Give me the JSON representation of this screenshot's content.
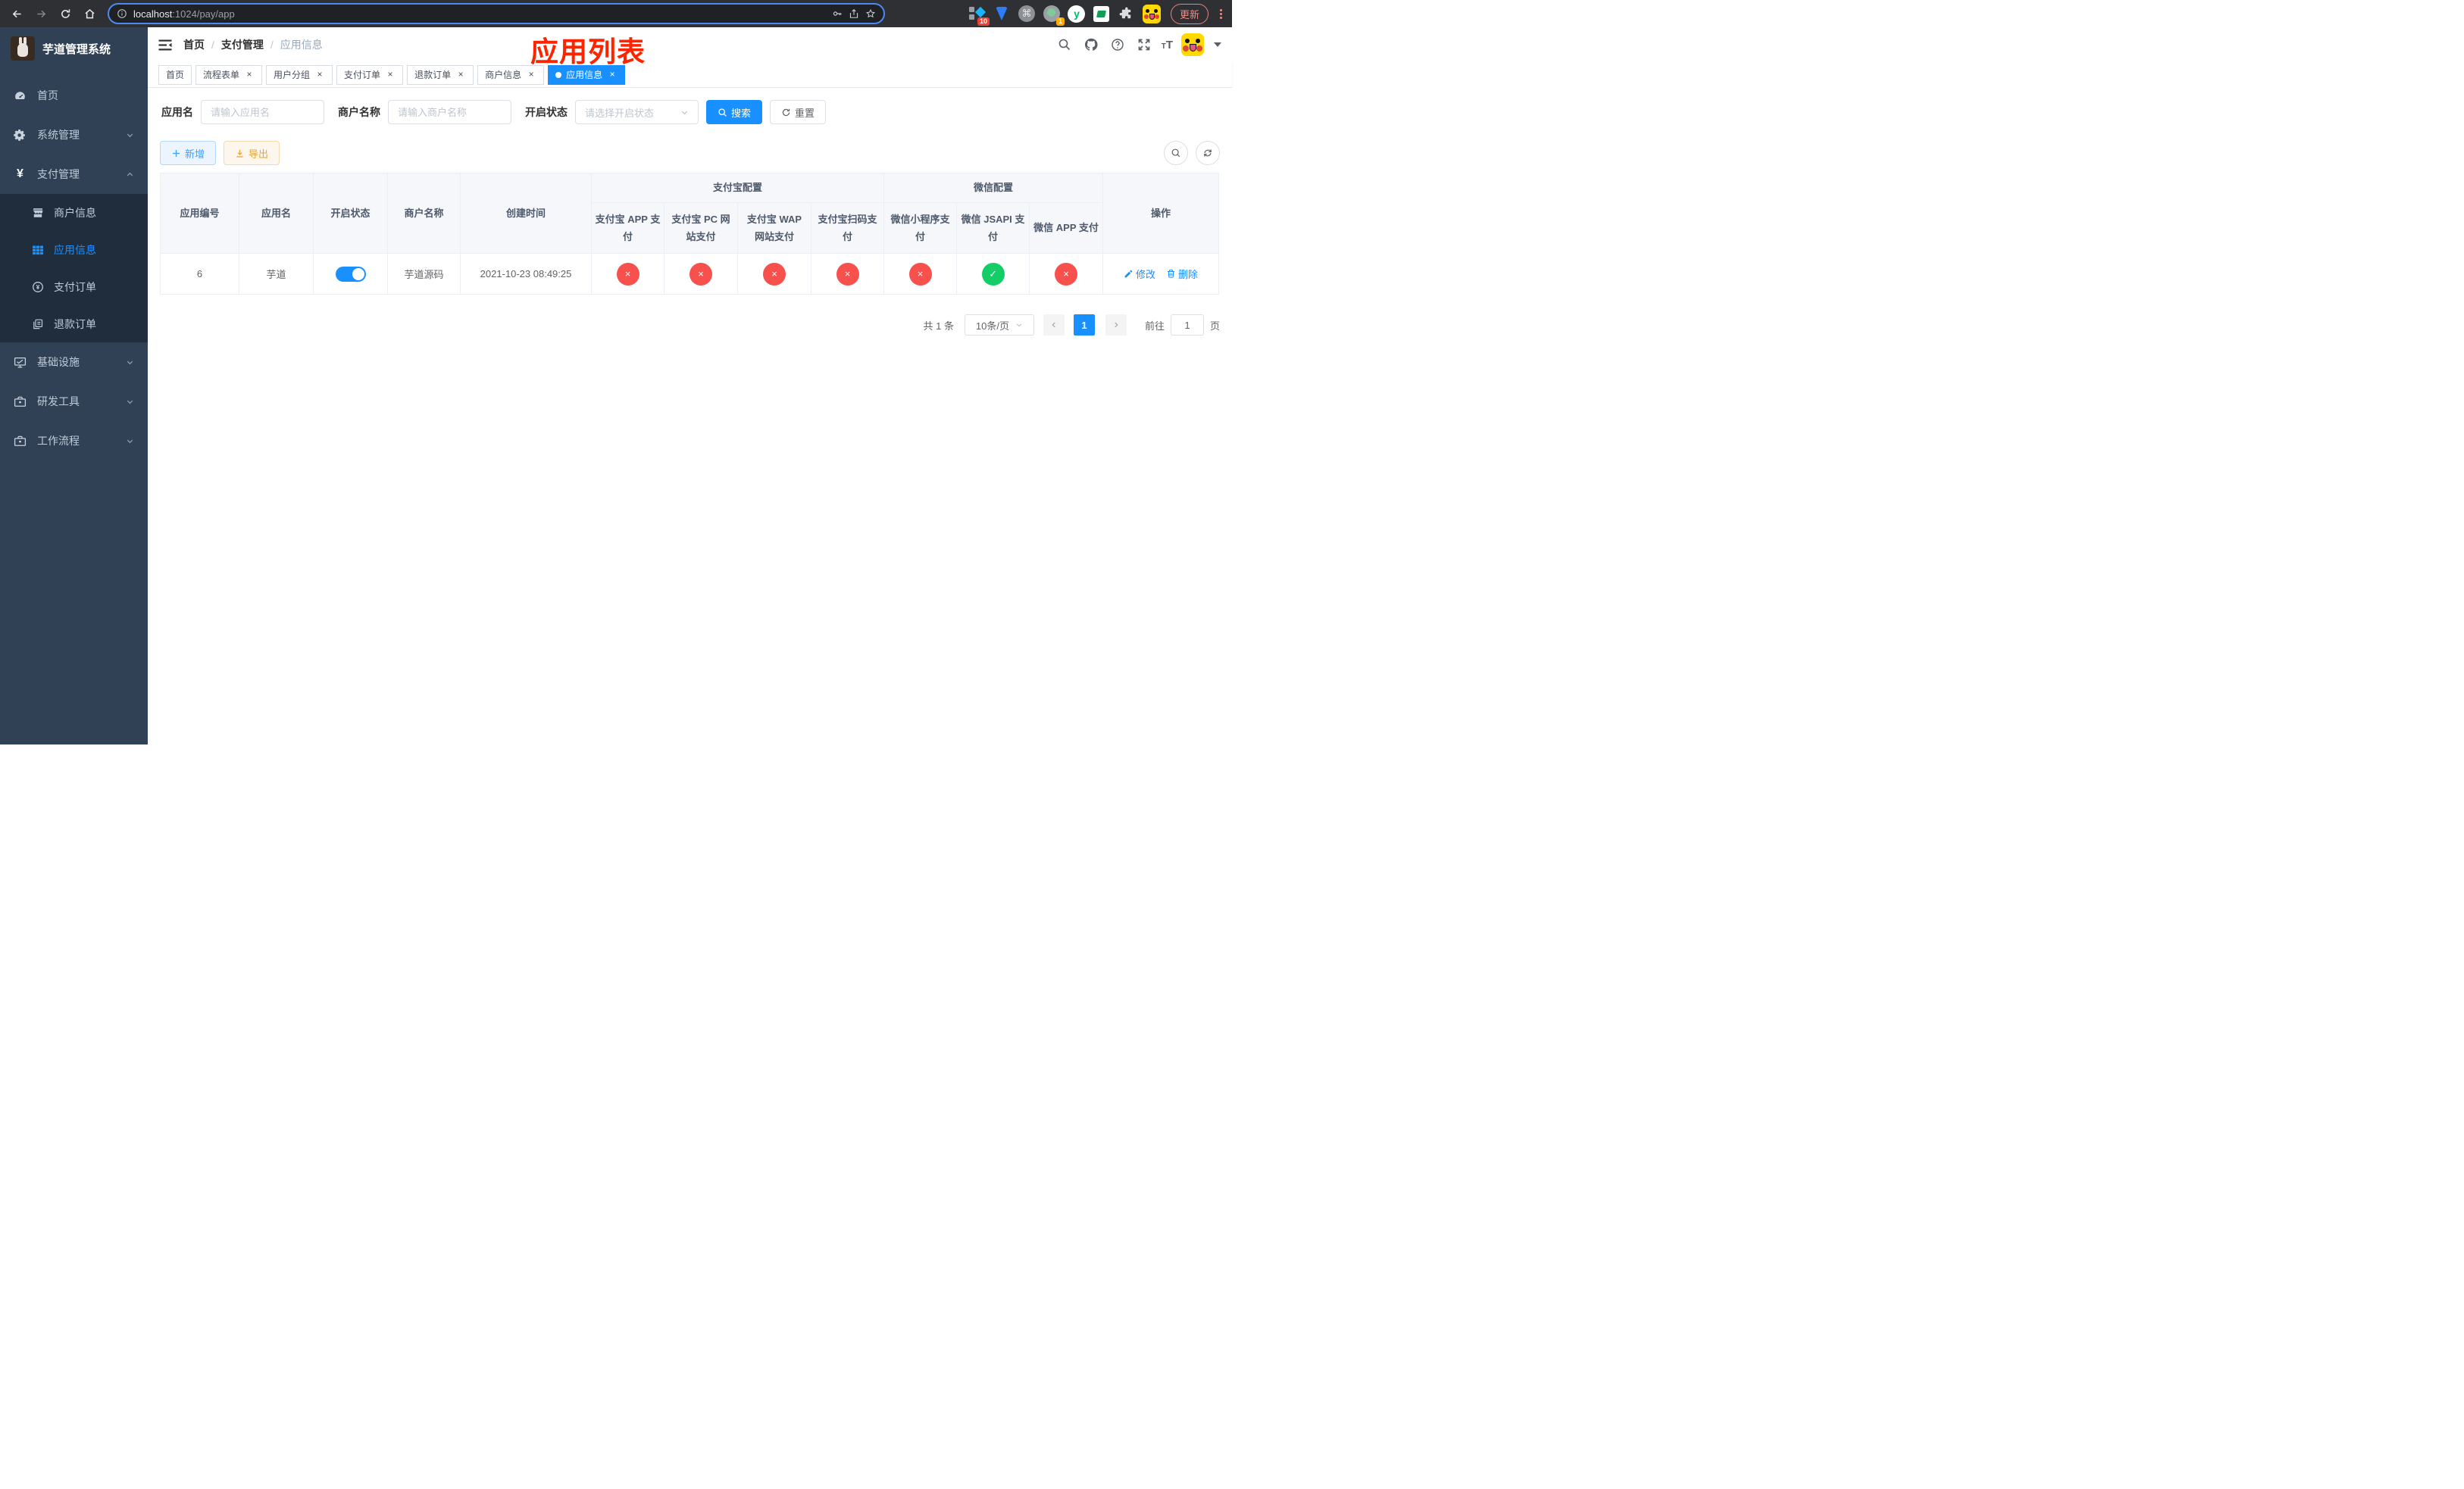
{
  "colors": {
    "accent": "#1890ff",
    "success": "#13ce66",
    "danger": "#f7504d",
    "sidebar_bg": "#304156",
    "submenu_bg": "#1f2d3d",
    "annotation_red": "#ff2400",
    "export_orange": "#e6a23c"
  },
  "browser": {
    "url_host": "localhost",
    "url_rest": ":1024/pay/app",
    "update_label": "更新",
    "ext_badge_diamond": "10",
    "ext_badge_dot": "1"
  },
  "sidebar": {
    "title": "芋道管理系统",
    "items": [
      {
        "label": "首页"
      },
      {
        "label": "系统管理"
      },
      {
        "label": "支付管理",
        "children": [
          {
            "label": "商户信息"
          },
          {
            "label": "应用信息",
            "active": true
          },
          {
            "label": "支付订单"
          },
          {
            "label": "退款订单"
          }
        ]
      },
      {
        "label": "基础设施"
      },
      {
        "label": "研发工具"
      },
      {
        "label": "工作流程"
      }
    ]
  },
  "navbar": {
    "breadcrumb": [
      "首页",
      "支付管理",
      "应用信息"
    ],
    "annotation": "应用列表"
  },
  "tabs": [
    {
      "label": "首页",
      "closable": false,
      "active": false
    },
    {
      "label": "流程表单",
      "closable": true,
      "active": false
    },
    {
      "label": "用户分组",
      "closable": true,
      "active": false
    },
    {
      "label": "支付订单",
      "closable": true,
      "active": false
    },
    {
      "label": "退款订单",
      "closable": true,
      "active": false
    },
    {
      "label": "商户信息",
      "closable": true,
      "active": false
    },
    {
      "label": "应用信息",
      "closable": true,
      "active": true
    }
  ],
  "filters": {
    "app_name_label": "应用名",
    "app_name_placeholder": "请输入应用名",
    "merchant_label": "商户名称",
    "merchant_placeholder": "请输入商户名称",
    "status_label": "开启状态",
    "status_placeholder": "请选择开启状态",
    "search_label": "搜索",
    "reset_label": "重置"
  },
  "toolbar": {
    "add_label": "新增",
    "export_label": "导出"
  },
  "table": {
    "group_headers": {
      "alipay": "支付宝配置",
      "wechat": "微信配置"
    },
    "columns": {
      "app_id": "应用编号",
      "app_name": "应用名",
      "status": "开启状态",
      "merchant": "商户名称",
      "created": "创建时间",
      "alipay_app": "支付宝 APP 支付",
      "alipay_pc": "支付宝 PC 网站支付",
      "alipay_wap": "支付宝 WAP 网站支付",
      "alipay_qr": "支付宝扫码支付",
      "wx_lite": "微信小程序支付",
      "wx_jsapi": "微信 JSAPI 支付",
      "wx_app": "微信 APP 支付",
      "actions": "操作"
    },
    "row": {
      "app_id": "6",
      "app_name": "芋道",
      "enabled": true,
      "merchant": "芋道源码",
      "created": "2021-10-23 08:49:25",
      "configs": {
        "alipay_app": false,
        "alipay_pc": false,
        "alipay_wap": false,
        "alipay_qr": false,
        "wx_lite": false,
        "wx_jsapi": true,
        "wx_app": false
      },
      "edit_label": "修改",
      "delete_label": "删除"
    }
  },
  "pagination": {
    "total": "共 1 条",
    "page_size": "10条/页",
    "current_page": "1",
    "goto_label": "前往",
    "goto_value": "1",
    "page_suffix": "页"
  }
}
